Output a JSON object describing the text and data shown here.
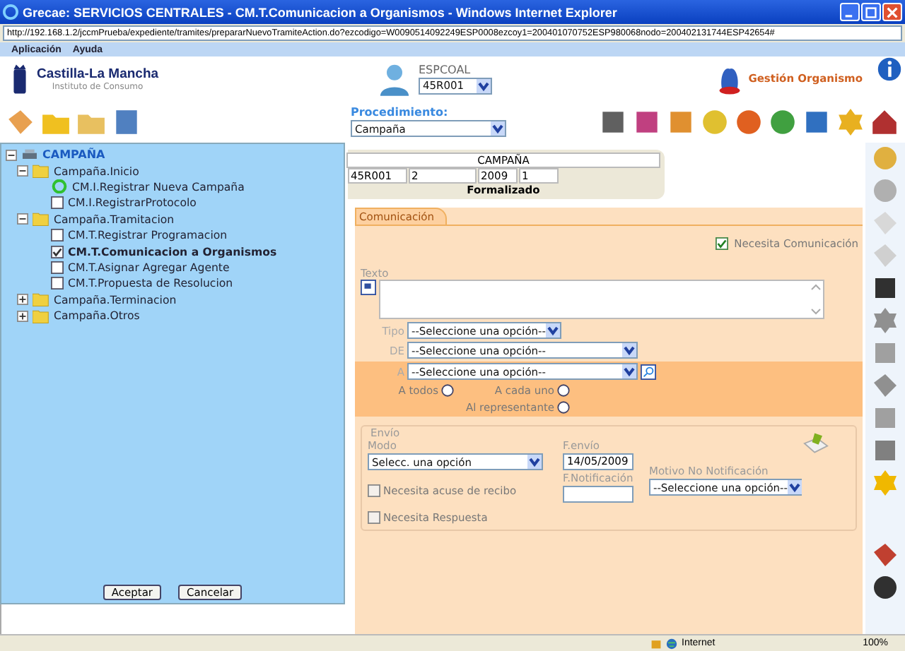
{
  "window": {
    "title": "Grecae: SERVICIOS CENTRALES - CM.T.Comunicacion a Organismos - Windows Internet Explorer"
  },
  "address": "http://192.168.1.2/jccmPrueba/expediente/tramites/prepararNuevoTramiteAction.do?ezcodigo=W0090514092249ESP0008ezcoy1=200401070752ESP980068nodo=200402131744ESP42654#",
  "menu": [
    "Aplicación",
    "Ayuda"
  ],
  "header": {
    "logo_title": "Castilla-La Mancha",
    "logo_subtitle": "Instituto de Consumo",
    "user": "ESPCOAL",
    "office": "45R001",
    "org_label": "Gestión Organismo"
  },
  "procedure": {
    "label": "Procedimiento:",
    "value": "Campaña"
  },
  "tree": {
    "label": "CAMPAÑA",
    "expanded": true,
    "children": [
      {
        "kind": "folder",
        "label": "Campaña.Inicio",
        "expanded": true,
        "children": [
          {
            "kind": "running-task",
            "label": "CM.I.Registrar Nueva Campaña",
            "selected": false
          },
          {
            "kind": "task",
            "label": "CM.I.RegistrarProtocolo",
            "checked": false,
            "selected": false
          }
        ]
      },
      {
        "kind": "folder",
        "label": "Campaña.Tramitacion",
        "expanded": true,
        "children": [
          {
            "kind": "task",
            "label": "CM.T.Registrar Programacion",
            "checked": false,
            "selected": false
          },
          {
            "kind": "task",
            "label": "CM.T.Comunicacion a Organismos",
            "checked": true,
            "selected": true
          },
          {
            "kind": "task",
            "label": "CM.T.Asignar Agregar Agente",
            "checked": false,
            "selected": false
          },
          {
            "kind": "task",
            "label": "CM.T.Propuesta de Resolucion",
            "checked": false,
            "selected": false
          }
        ]
      },
      {
        "kind": "folder",
        "label": "Campaña.Terminacion",
        "expanded": false
      },
      {
        "kind": "folder",
        "label": "Campaña.Otros",
        "expanded": false
      }
    ]
  },
  "tree_buttons": [
    "Aceptar",
    "Cancelar"
  ],
  "record": {
    "title": "CAMPAÑA",
    "fields": [
      "45R001",
      "2",
      "2009",
      "1"
    ],
    "status": "Formalizado"
  },
  "tabs": [
    {
      "label": "Comunicación",
      "selected": true
    }
  ],
  "form": {
    "needs_communication": {
      "label": "Necesita Comunicación",
      "checked": true
    },
    "text": {
      "label": "Texto"
    },
    "tipo": {
      "label": "Tipo",
      "value": "--Seleccione una opción--"
    },
    "de": {
      "label": "DE",
      "value": "--Seleccione una opción--"
    },
    "a": {
      "label": "A",
      "value": "--Seleccione una opción--"
    },
    "radios": [
      {
        "label": "A todos",
        "selected": false
      },
      {
        "label": "A cada uno",
        "selected": false
      },
      {
        "label": "Al representante",
        "selected": false
      }
    ],
    "envio": {
      "legend": "Envío",
      "modo": {
        "label": "Modo",
        "value": "Selecc. una opción"
      },
      "fecha_envio": {
        "label": "F.envío",
        "value": "14/05/2009"
      },
      "fecha_notificacion": {
        "label": "F.Notificación"
      },
      "motivo": {
        "label": "Motivo No Notificación",
        "value": "--Seleccione una opción--"
      },
      "checks": [
        {
          "label": "Necesita acuse de recibo",
          "checked": false
        },
        {
          "label": "Necesita Respuesta",
          "checked": false
        }
      ]
    }
  },
  "status_bar": {
    "zone": "Internet",
    "zoom": "100%"
  }
}
